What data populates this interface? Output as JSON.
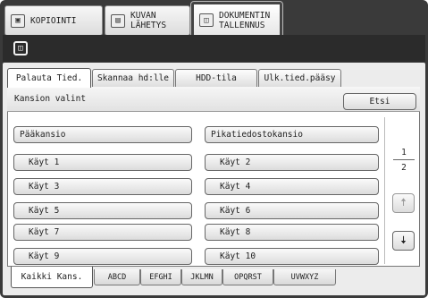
{
  "mode_tabs": [
    {
      "label": "KOPIOINTI",
      "icon": "copy-icon"
    },
    {
      "label": "KUVAN\nLÄHETYS",
      "icon": "image-send-icon"
    },
    {
      "label": "DOKUMENTIN\nTALLENNUS",
      "icon": "document-filing-icon"
    }
  ],
  "subbar": {
    "icon": "document-filing-icon"
  },
  "folder_tabs": [
    {
      "label": "Palauta Tied."
    },
    {
      "label": "Skannaa hd:lle"
    },
    {
      "label": "HDD-tila"
    },
    {
      "label": "Ulk.tied.pääsy"
    }
  ],
  "folder_select": {
    "title": "Kansion valint",
    "search_label": "Etsi"
  },
  "folders": {
    "main": "Pääkansio",
    "quick": "Pikatiedostokansio",
    "users": [
      "Käyt 1",
      "Käyt 2",
      "Käyt 3",
      "Käyt 4",
      "Käyt 5",
      "Käyt 6",
      "Käyt 7",
      "Käyt 8",
      "Käyt 9",
      "Käyt 10"
    ]
  },
  "pagination": {
    "current": "1",
    "total": "2"
  },
  "index_tabs": [
    "Kaikki Kans.",
    "ABCD",
    "EFGHI",
    "JKLMN",
    "OPQRST",
    "UVWXYZ"
  ],
  "colors": {
    "frame": "#3a3a3a",
    "subbar": "#2b2b2b",
    "panel": "#ececec"
  }
}
